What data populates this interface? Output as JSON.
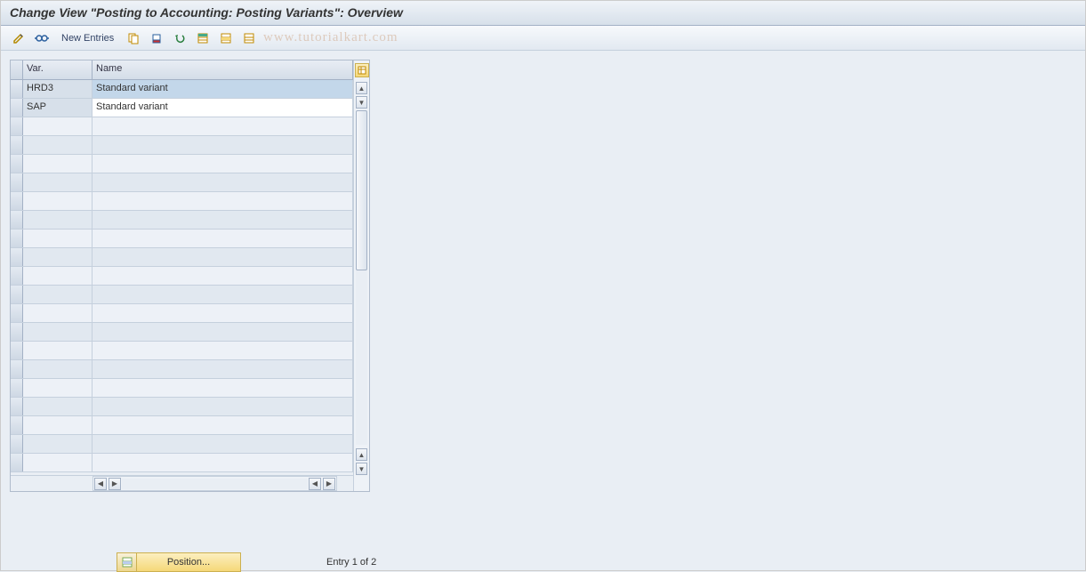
{
  "title": "Change View \"Posting to Accounting: Posting Variants\": Overview",
  "toolbar": {
    "new_entries_label": "New Entries",
    "watermark": "www.tutorialkart.com",
    "icons": {
      "pencil": "change-icon",
      "glasses": "display-icon",
      "copy": "copy-icon",
      "delete": "delete-icon",
      "undo": "undo-icon",
      "select_all": "select-all-icon",
      "select_block": "select-block-icon",
      "deselect": "deselect-icon"
    }
  },
  "table": {
    "columns": {
      "var": "Var.",
      "name": "Name"
    },
    "rows": [
      {
        "var": "HRD3",
        "name": "Standard variant",
        "selected": true
      },
      {
        "var": "SAP",
        "name": "Standard variant",
        "selected": false
      }
    ],
    "empty_row_count": 19
  },
  "footer": {
    "position_label": "Position...",
    "entry_status": "Entry 1 of 2"
  }
}
